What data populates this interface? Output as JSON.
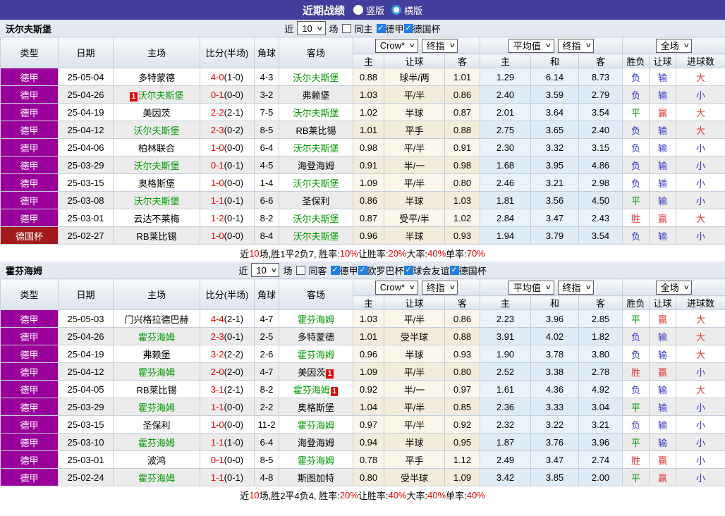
{
  "title_bar": {
    "title": "近期战绩",
    "radios": [
      {
        "label": "竖版",
        "selected": false
      },
      {
        "label": "横版",
        "selected": true
      }
    ]
  },
  "filter": {
    "recent_prefix": "近",
    "recent_suffix": "场"
  },
  "selects": {
    "recent_count": "10",
    "bookmaker": "Crow*",
    "bookmaker_stage": "终指",
    "average": "平均值",
    "average_stage": "终指",
    "scope": "全场"
  },
  "columns": {
    "type": "类型",
    "date": "日期",
    "home": "主场",
    "score": "比分(半场)",
    "corner": "角球",
    "away": "客场",
    "odds_home": "主",
    "odds_handicap": "让球",
    "odds_away": "客",
    "avg_home": "主",
    "avg_draw": "和",
    "avg_away": "客",
    "result_wdl": "胜负",
    "result_handicap": "让球",
    "result_goals": "进球数"
  },
  "league_colors": {
    "德甲": "#990099",
    "德国杯": "#A31A1A"
  },
  "result_colors": {
    "负": "blue",
    "平": "green",
    "胜": "red",
    "输": "blue",
    "赢": "red",
    "大": "red",
    "小": "blue"
  },
  "accent_colors": {
    "focal_team": "#009900",
    "score": "#E60000",
    "header_bar": "#423E9C",
    "checkbox": "#1E7FE8"
  },
  "tables": [
    {
      "team": "沃尔夫斯堡",
      "same_label": "同主",
      "same_checked": false,
      "leagues": [
        {
          "label": "德甲",
          "checked": true
        },
        {
          "label": "德国杯",
          "checked": true
        }
      ],
      "rows": [
        {
          "league": "德甲",
          "date": "25-05-04",
          "home": {
            "name": "多特蒙德",
            "focal": false
          },
          "score": "4-0",
          "half": "(1-0)",
          "corner": "4-3",
          "away": {
            "name": "沃尔夫斯堡",
            "focal": true
          },
          "odds": [
            "0.88",
            "球半/两",
            "1.01"
          ],
          "avg": [
            "1.29",
            "6.14",
            "8.73"
          ],
          "res": [
            "负",
            "输",
            "大"
          ]
        },
        {
          "league": "德甲",
          "date": "25-04-26",
          "home": {
            "name": "沃尔夫斯堡",
            "focal": true,
            "badge": "1",
            "badge_pos": "before"
          },
          "score": "0-1",
          "half": "(0-0)",
          "corner": "3-2",
          "away": {
            "name": "弗赖堡",
            "focal": false
          },
          "odds": [
            "1.03",
            "平/半",
            "0.86"
          ],
          "avg": [
            "2.40",
            "3.59",
            "2.79"
          ],
          "res": [
            "负",
            "输",
            "小"
          ]
        },
        {
          "league": "德甲",
          "date": "25-04-19",
          "home": {
            "name": "美因茨",
            "focal": false
          },
          "score": "2-2",
          "half": "(2-1)",
          "corner": "7-5",
          "away": {
            "name": "沃尔夫斯堡",
            "focal": true
          },
          "odds": [
            "1.02",
            "半球",
            "0.87"
          ],
          "avg": [
            "2.01",
            "3.64",
            "3.54"
          ],
          "res": [
            "平",
            "赢",
            "大"
          ]
        },
        {
          "league": "德甲",
          "date": "25-04-12",
          "home": {
            "name": "沃尔夫斯堡",
            "focal": true
          },
          "score": "2-3",
          "half": "(0-2)",
          "corner": "8-5",
          "away": {
            "name": "RB莱比锡",
            "focal": false
          },
          "odds": [
            "1.01",
            "平手",
            "0.88"
          ],
          "avg": [
            "2.75",
            "3.65",
            "2.40"
          ],
          "res": [
            "负",
            "输",
            "大"
          ]
        },
        {
          "league": "德甲",
          "date": "25-04-06",
          "home": {
            "name": "柏林联合",
            "focal": false
          },
          "score": "1-0",
          "half": "(0-0)",
          "corner": "6-4",
          "away": {
            "name": "沃尔夫斯堡",
            "focal": true
          },
          "odds": [
            "0.98",
            "平/半",
            "0.91"
          ],
          "avg": [
            "2.30",
            "3.32",
            "3.15"
          ],
          "res": [
            "负",
            "输",
            "小"
          ]
        },
        {
          "league": "德甲",
          "date": "25-03-29",
          "home": {
            "name": "沃尔夫斯堡",
            "focal": true
          },
          "score": "0-1",
          "half": "(0-1)",
          "corner": "4-5",
          "away": {
            "name": "海登海姆",
            "focal": false
          },
          "odds": [
            "0.91",
            "半/一",
            "0.98"
          ],
          "avg": [
            "1.68",
            "3.95",
            "4.86"
          ],
          "res": [
            "负",
            "输",
            "小"
          ]
        },
        {
          "league": "德甲",
          "date": "25-03-15",
          "home": {
            "name": "奥格斯堡",
            "focal": false
          },
          "score": "1-0",
          "half": "(0-0)",
          "corner": "1-4",
          "away": {
            "name": "沃尔夫斯堡",
            "focal": true
          },
          "odds": [
            "1.09",
            "平/半",
            "0.80"
          ],
          "avg": [
            "2.46",
            "3.21",
            "2.98"
          ],
          "res": [
            "负",
            "输",
            "小"
          ]
        },
        {
          "league": "德甲",
          "date": "25-03-08",
          "home": {
            "name": "沃尔夫斯堡",
            "focal": true
          },
          "score": "1-1",
          "half": "(0-1)",
          "corner": "6-6",
          "away": {
            "name": "圣保利",
            "focal": false
          },
          "odds": [
            "0.86",
            "半球",
            "1.03"
          ],
          "avg": [
            "1.81",
            "3.56",
            "4.50"
          ],
          "res": [
            "平",
            "输",
            "小"
          ]
        },
        {
          "league": "德甲",
          "date": "25-03-01",
          "home": {
            "name": "云达不莱梅",
            "focal": false
          },
          "score": "1-2",
          "half": "(0-1)",
          "corner": "8-2",
          "away": {
            "name": "沃尔夫斯堡",
            "focal": true
          },
          "odds": [
            "0.87",
            "受平/半",
            "1.02"
          ],
          "avg": [
            "2.84",
            "3.47",
            "2.43"
          ],
          "res": [
            "胜",
            "赢",
            "大"
          ]
        },
        {
          "league": "德国杯",
          "date": "25-02-27",
          "home": {
            "name": "RB莱比锡",
            "focal": false
          },
          "score": "1-0",
          "half": "(0-0)",
          "corner": "8-4",
          "away": {
            "name": "沃尔夫斯堡",
            "focal": true
          },
          "odds": [
            "0.96",
            "半球",
            "0.93"
          ],
          "avg": [
            "1.94",
            "3.79",
            "3.54"
          ],
          "res": [
            "负",
            "输",
            "小"
          ]
        }
      ],
      "summary": [
        {
          "t": "近"
        },
        {
          "t": "10",
          "r": 1
        },
        {
          "t": "场,胜1平2负7, 胜率:"
        },
        {
          "t": "10%",
          "r": 1
        },
        {
          "t": " 让胜率:"
        },
        {
          "t": "20%",
          "r": 1
        },
        {
          "t": " 大率:"
        },
        {
          "t": "40%",
          "r": 1
        },
        {
          "t": " 单率:"
        },
        {
          "t": "70%",
          "r": 1
        }
      ]
    },
    {
      "team": "霍芬海姆",
      "same_label": "同客",
      "same_checked": false,
      "leagues": [
        {
          "label": "德甲",
          "checked": true
        },
        {
          "label": "欧罗巴杯",
          "checked": true
        },
        {
          "label": "球会友谊",
          "checked": true
        },
        {
          "label": "德国杯",
          "checked": true
        }
      ],
      "rows": [
        {
          "league": "德甲",
          "date": "25-05-03",
          "home": {
            "name": "门兴格拉德巴赫",
            "focal": false
          },
          "score": "4-4",
          "half": "(2-1)",
          "corner": "4-7",
          "away": {
            "name": "霍芬海姆",
            "focal": true
          },
          "odds": [
            "1.03",
            "平/半",
            "0.86"
          ],
          "avg": [
            "2.23",
            "3.96",
            "2.85"
          ],
          "res": [
            "平",
            "赢",
            "大"
          ]
        },
        {
          "league": "德甲",
          "date": "25-04-26",
          "home": {
            "name": "霍芬海姆",
            "focal": true
          },
          "score": "2-3",
          "half": "(0-1)",
          "corner": "2-5",
          "away": {
            "name": "多特蒙德",
            "focal": false
          },
          "odds": [
            "1.01",
            "受半球",
            "0.88"
          ],
          "avg": [
            "3.91",
            "4.02",
            "1.82"
          ],
          "res": [
            "负",
            "输",
            "大"
          ]
        },
        {
          "league": "德甲",
          "date": "25-04-19",
          "home": {
            "name": "弗赖堡",
            "focal": false
          },
          "score": "3-2",
          "half": "(2-2)",
          "corner": "2-6",
          "away": {
            "name": "霍芬海姆",
            "focal": true
          },
          "odds": [
            "0.96",
            "半球",
            "0.93"
          ],
          "avg": [
            "1.90",
            "3.78",
            "3.80"
          ],
          "res": [
            "负",
            "输",
            "大"
          ]
        },
        {
          "league": "德甲",
          "date": "25-04-12",
          "home": {
            "name": "霍芬海姆",
            "focal": true
          },
          "score": "2-0",
          "half": "(2-0)",
          "corner": "4-7",
          "away": {
            "name": "美因茨",
            "focal": false,
            "badge": "1",
            "badge_pos": "after"
          },
          "odds": [
            "1.09",
            "平/半",
            "0.80"
          ],
          "avg": [
            "2.52",
            "3.38",
            "2.78"
          ],
          "res": [
            "胜",
            "赢",
            "小"
          ]
        },
        {
          "league": "德甲",
          "date": "25-04-05",
          "home": {
            "name": "RB莱比锡",
            "focal": false
          },
          "score": "3-1",
          "half": "(2-1)",
          "corner": "8-2",
          "away": {
            "name": "霍芬海姆",
            "focal": true,
            "badge": "1",
            "badge_pos": "after"
          },
          "odds": [
            "0.92",
            "半/一",
            "0.97"
          ],
          "avg": [
            "1.61",
            "4.36",
            "4.92"
          ],
          "res": [
            "负",
            "输",
            "大"
          ]
        },
        {
          "league": "德甲",
          "date": "25-03-29",
          "home": {
            "name": "霍芬海姆",
            "focal": true
          },
          "score": "1-1",
          "half": "(0-0)",
          "corner": "2-2",
          "away": {
            "name": "奥格斯堡",
            "focal": false
          },
          "odds": [
            "1.04",
            "平/半",
            "0.85"
          ],
          "avg": [
            "2.36",
            "3.33",
            "3.04"
          ],
          "res": [
            "平",
            "输",
            "小"
          ]
        },
        {
          "league": "德甲",
          "date": "25-03-15",
          "home": {
            "name": "圣保利",
            "focal": false
          },
          "score": "1-0",
          "half": "(0-0)",
          "corner": "11-2",
          "away": {
            "name": "霍芬海姆",
            "focal": true
          },
          "odds": [
            "0.97",
            "平/半",
            "0.92"
          ],
          "avg": [
            "2.32",
            "3.22",
            "3.21"
          ],
          "res": [
            "负",
            "输",
            "小"
          ]
        },
        {
          "league": "德甲",
          "date": "25-03-10",
          "home": {
            "name": "霍芬海姆",
            "focal": true
          },
          "score": "1-1",
          "half": "(1-0)",
          "corner": "6-4",
          "away": {
            "name": "海登海姆",
            "focal": false
          },
          "odds": [
            "0.94",
            "半球",
            "0.95"
          ],
          "avg": [
            "1.87",
            "3.76",
            "3.96"
          ],
          "res": [
            "平",
            "输",
            "小"
          ]
        },
        {
          "league": "德甲",
          "date": "25-03-01",
          "home": {
            "name": "波鸿",
            "focal": false
          },
          "score": "0-1",
          "half": "(0-0)",
          "corner": "8-5",
          "away": {
            "name": "霍芬海姆",
            "focal": true
          },
          "odds": [
            "0.78",
            "平手",
            "1.12"
          ],
          "avg": [
            "2.49",
            "3.47",
            "2.74"
          ],
          "res": [
            "胜",
            "赢",
            "小"
          ]
        },
        {
          "league": "德甲",
          "date": "25-02-24",
          "home": {
            "name": "霍芬海姆",
            "focal": true
          },
          "score": "1-1",
          "half": "(0-1)",
          "corner": "4-8",
          "away": {
            "name": "斯图加特",
            "focal": false
          },
          "odds": [
            "0.80",
            "受半球",
            "1.09"
          ],
          "avg": [
            "3.42",
            "3.85",
            "2.00"
          ],
          "res": [
            "平",
            "赢",
            "小"
          ]
        }
      ],
      "summary": [
        {
          "t": "近"
        },
        {
          "t": "10",
          "r": 1
        },
        {
          "t": "场,胜2平4负4, 胜率:"
        },
        {
          "t": "20%",
          "r": 1
        },
        {
          "t": " 让胜率:"
        },
        {
          "t": "40%",
          "r": 1
        },
        {
          "t": " 大率:"
        },
        {
          "t": "40%",
          "r": 1
        },
        {
          "t": " 单率:"
        },
        {
          "t": "40%",
          "r": 1
        }
      ]
    }
  ]
}
